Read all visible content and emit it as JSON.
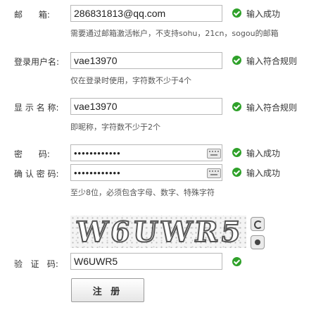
{
  "form": {
    "email": {
      "label": "邮      箱:",
      "value": "286831813@qq.com",
      "status": "输入成功",
      "hint": "需要通过邮箱激活帐户，不支持sohu，21cn，sogou的邮箱"
    },
    "username": {
      "label": "登录用户名:",
      "value": "vae13970",
      "status": "输入符合规则",
      "hint": "仅在登录时使用，字符数不少于4个"
    },
    "nickname": {
      "label": "显 示 名 称:",
      "value": "vae13970",
      "status": "输入符合规则",
      "hint": "即昵称，字符数不少于2个"
    },
    "password": {
      "label": "密      码:",
      "value": "••••••••••••",
      "status": "输入成功"
    },
    "confirm_password": {
      "label": "确 认 密 码:",
      "value": "••••••••••••",
      "status": "输入成功",
      "hint": "至少8位，必须包含字母、数字、特殊字符"
    },
    "captcha": {
      "image_text": "W6UWR5",
      "label": "验   证   码:",
      "value": "W6UWR5"
    },
    "submit_label": "注 册"
  },
  "icons": {
    "status": "check-circle-icon",
    "keyboard": "keyboard-icon",
    "refresh": "refresh-icon",
    "audio": "audio-icon"
  },
  "colors": {
    "success": "#2fa12a",
    "input_border": "#b8b8b8"
  }
}
